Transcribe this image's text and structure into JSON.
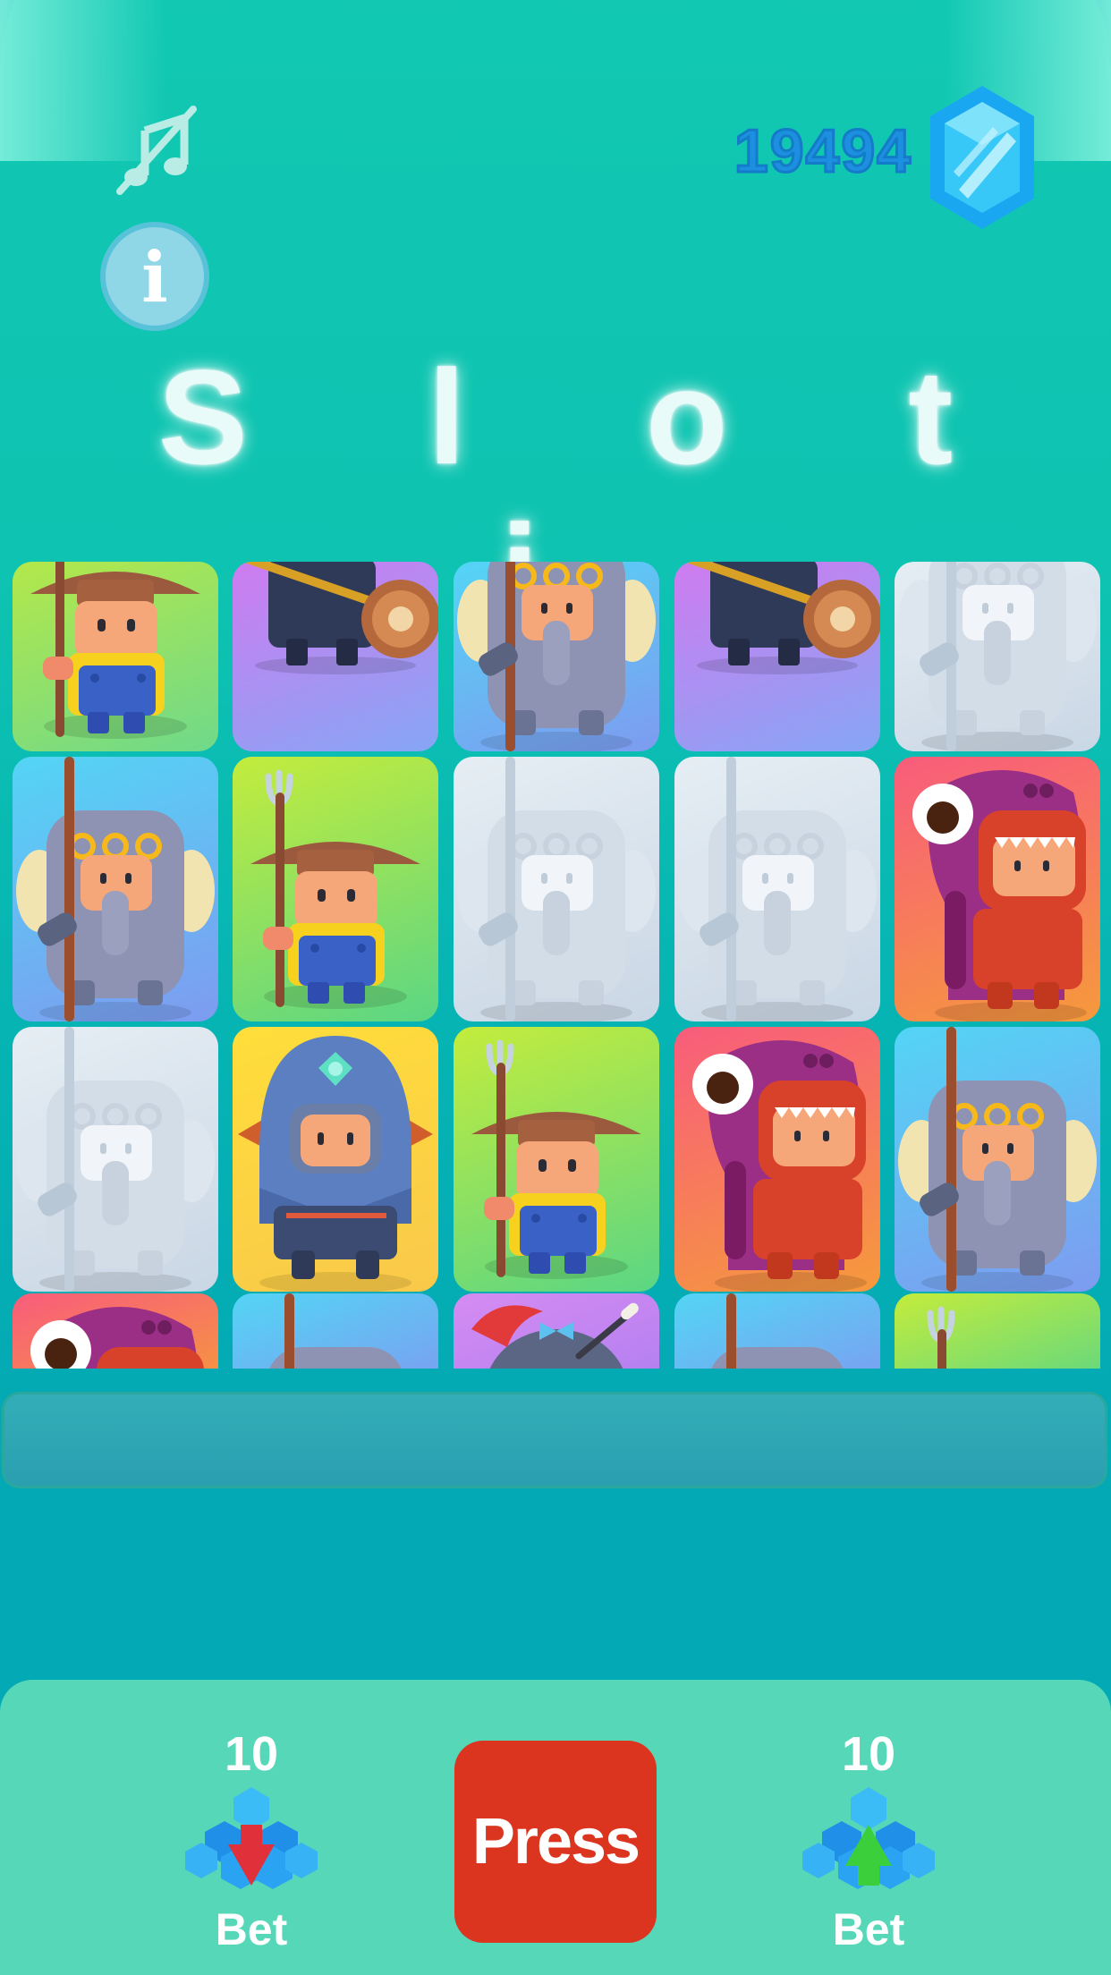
{
  "app": {
    "title": "S l o t i",
    "score": "19494"
  },
  "icons": {
    "music": "music-off-icon",
    "info": "info-icon",
    "currency": "gem-icon"
  },
  "info_glyph": "i",
  "reels": [
    [
      "farmer",
      "knight",
      "elephant-warrior",
      "knight",
      "elephant-ghost"
    ],
    [
      "elephant-warrior",
      "farmer-trident",
      "elephant-ghost",
      "elephant-ghost",
      "octopus"
    ],
    [
      "elephant-ghost",
      "mage",
      "farmer-trident",
      "octopus",
      "elephant-warrior"
    ],
    [
      "octopus",
      "elephant-warrior",
      "bird-gentleman",
      "elephant-warrior",
      "farmer-trident"
    ]
  ],
  "controls": {
    "bet_down": {
      "value": "10",
      "label": "Bet",
      "icon": "bet-decrease-icon"
    },
    "press": {
      "label": "Press"
    },
    "bet_up": {
      "value": "10",
      "label": "Bet",
      "icon": "bet-increase-icon"
    }
  },
  "colors": {
    "primary_bg": "#12c9b3",
    "panel": "#56d7b8",
    "press_button": "#db3520",
    "score": "#1c8fe0"
  }
}
